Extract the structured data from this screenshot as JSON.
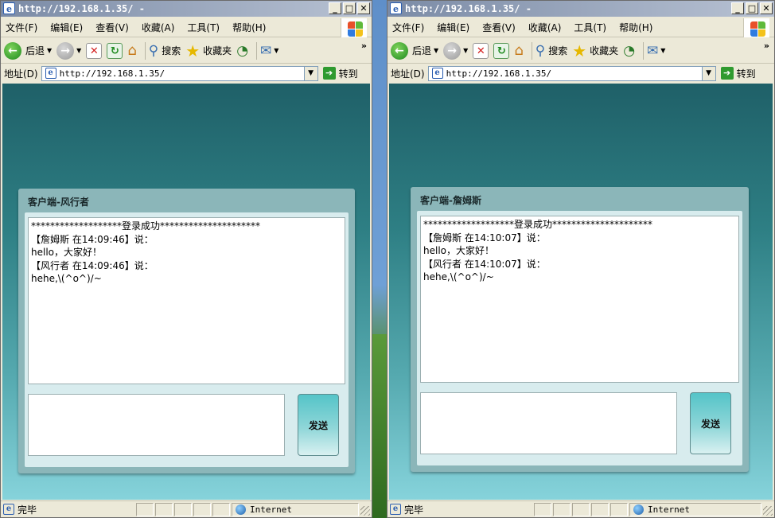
{
  "windows": [
    {
      "id": "left",
      "title": "http://192.168.1.35/ -",
      "menu": [
        "文件(F)",
        "编辑(E)",
        "查看(V)",
        "收藏(A)",
        "工具(T)",
        "帮助(H)"
      ],
      "toolbar": {
        "back": "后退",
        "search": "搜索",
        "favorites": "收藏夹"
      },
      "address": {
        "label": "地址(D)",
        "url": "http://192.168.1.35/",
        "go": "转到"
      },
      "panel": {
        "title": "客户端-风行者",
        "log": [
          "*******************登录成功*********************",
          "【詹姆斯 在14:09:46】说：",
          "hello，大家好！",
          "【风行者 在14:09:46】说：",
          "hehe,\\(^o^)/~"
        ],
        "send": "发送"
      },
      "status": {
        "text": "完毕",
        "zone": "Internet"
      }
    },
    {
      "id": "right",
      "title": "http://192.168.1.35/ -",
      "menu": [
        "文件(F)",
        "编辑(E)",
        "查看(V)",
        "收藏(A)",
        "工具(T)",
        "帮助(H)"
      ],
      "toolbar": {
        "back": "后退",
        "search": "搜索",
        "favorites": "收藏夹"
      },
      "address": {
        "label": "地址(D)",
        "url": "http://192.168.1.35/",
        "go": "转到"
      },
      "panel": {
        "title": "客户端-詹姆斯",
        "log": [
          "*******************登录成功*********************",
          "【詹姆斯 在14:10:07】说：",
          "hello，大家好！",
          "【风行者 在14:10:07】说：",
          "hehe,\\(^o^)/~"
        ],
        "send": "发送"
      },
      "status": {
        "text": "完毕",
        "zone": "Internet"
      }
    }
  ],
  "icons": [
    "ie-icon",
    "back-icon",
    "forward-icon",
    "stop-icon",
    "refresh-icon",
    "home-icon",
    "search-icon",
    "favorites-icon",
    "history-icon",
    "mail-icon",
    "go-icon",
    "globe-icon"
  ]
}
